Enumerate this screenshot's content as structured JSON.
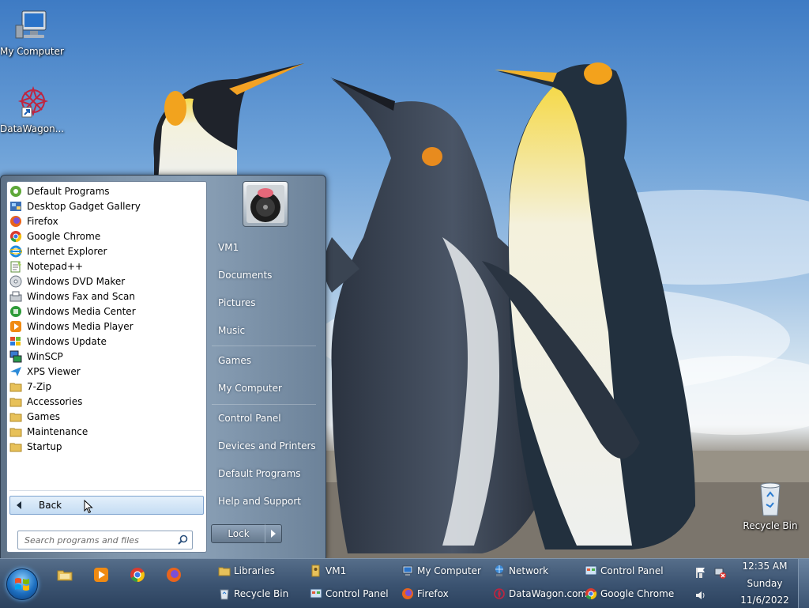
{
  "desktop": {
    "icons": [
      {
        "label": "My Computer",
        "icon": "computer-icon"
      },
      {
        "label": "DataWagon...",
        "icon": "datawagon-icon"
      },
      {
        "label": "Recycle Bin",
        "icon": "recycle-bin-icon"
      }
    ]
  },
  "start_menu": {
    "programs": [
      {
        "label": "Default Programs",
        "icon": "default-programs-icon"
      },
      {
        "label": "Desktop Gadget Gallery",
        "icon": "gadget-gallery-icon"
      },
      {
        "label": "Firefox",
        "icon": "firefox-icon"
      },
      {
        "label": "Google Chrome",
        "icon": "chrome-icon"
      },
      {
        "label": "Internet Explorer",
        "icon": "internet-explorer-icon"
      },
      {
        "label": "Notepad++",
        "icon": "notepadpp-icon"
      },
      {
        "label": "Windows DVD Maker",
        "icon": "dvd-maker-icon"
      },
      {
        "label": "Windows Fax and Scan",
        "icon": "fax-scan-icon"
      },
      {
        "label": "Windows Media Center",
        "icon": "media-center-icon"
      },
      {
        "label": "Windows Media Player",
        "icon": "media-player-icon"
      },
      {
        "label": "Windows Update",
        "icon": "windows-update-icon"
      },
      {
        "label": "WinSCP",
        "icon": "winscp-icon"
      },
      {
        "label": "XPS Viewer",
        "icon": "xps-viewer-icon"
      },
      {
        "label": "7-Zip",
        "icon": "folder-icon"
      },
      {
        "label": "Accessories",
        "icon": "folder-icon"
      },
      {
        "label": "Games",
        "icon": "folder-icon"
      },
      {
        "label": "Maintenance",
        "icon": "folder-icon"
      },
      {
        "label": "Startup",
        "icon": "folder-icon"
      }
    ],
    "back_label": "Back",
    "search_placeholder": "Search programs and files",
    "right_items": [
      {
        "label": "VM1"
      },
      {
        "label": "Documents"
      },
      {
        "label": "Pictures"
      },
      {
        "label": "Music"
      },
      {
        "label": "Games"
      },
      {
        "label": "My Computer"
      },
      {
        "label": "Control Panel"
      },
      {
        "label": "Devices and Printers"
      },
      {
        "label": "Default Programs"
      },
      {
        "label": "Help and Support"
      }
    ],
    "lock_label": "Lock"
  },
  "taskbar": {
    "quick_launch": [
      {
        "icon": "explorer-folder-icon"
      },
      {
        "icon": "media-player-icon"
      },
      {
        "icon": "chrome-icon"
      },
      {
        "icon": "firefox-icon"
      }
    ],
    "row1": [
      {
        "label": "Libraries",
        "icon": "libraries-icon"
      },
      {
        "label": "VM1",
        "icon": "user-folder-icon"
      },
      {
        "label": "My Computer",
        "icon": "computer-icon"
      },
      {
        "label": "Network",
        "icon": "network-icon"
      },
      {
        "label": "Control Panel",
        "icon": "control-panel-icon"
      }
    ],
    "row2": [
      {
        "label": "Recycle Bin",
        "icon": "recycle-bin-icon"
      },
      {
        "label": "Control Panel",
        "icon": "control-panel-icon"
      },
      {
        "label": "Firefox",
        "icon": "firefox-icon"
      },
      {
        "label": "DataWagon.com",
        "icon": "datawagon-icon"
      },
      {
        "label": "Google Chrome",
        "icon": "chrome-icon"
      }
    ],
    "clock": {
      "time": "12:35 AM",
      "day": "Sunday",
      "date": "11/6/2022"
    }
  },
  "colors": {
    "taskbar": "#3c5472",
    "start_menu_right": "#7f95ab",
    "back_button": "#c4dcf3"
  }
}
